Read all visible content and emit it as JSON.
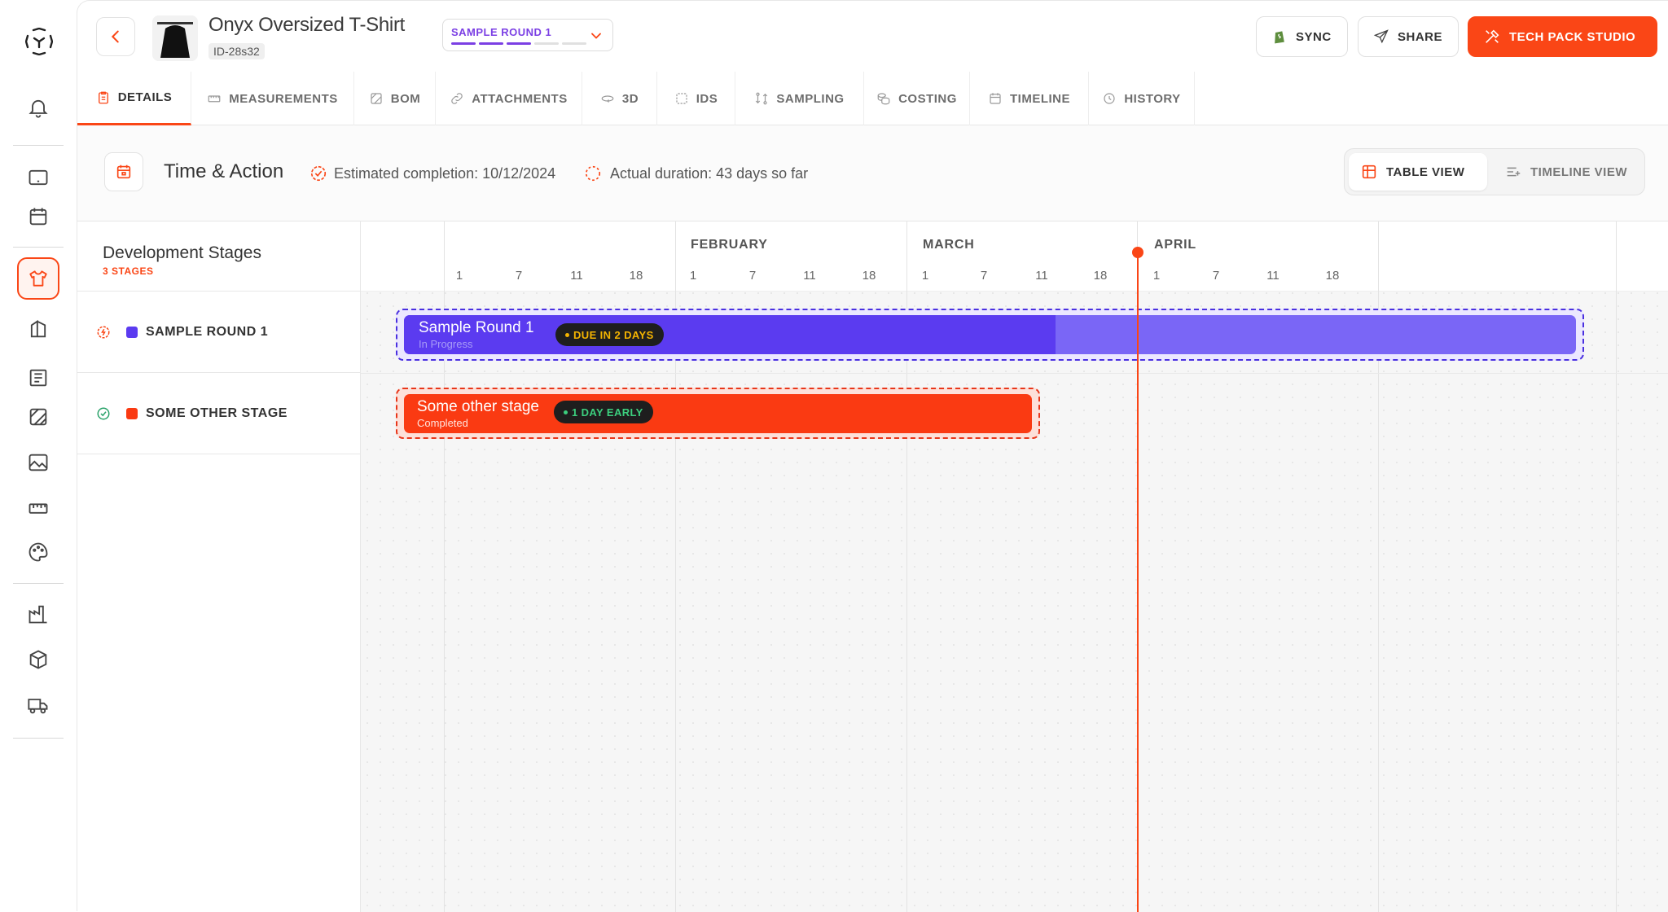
{
  "product": {
    "title": "Onyx Oversized T-Shirt",
    "id": "ID-28s32"
  },
  "round_selector": {
    "label": "SAMPLE ROUND 1",
    "progress_segments": 5,
    "progress_filled": 3
  },
  "header_buttons": {
    "sync": "SYNC",
    "share": "SHARE",
    "tech_pack": "TECH PACK STUDIO"
  },
  "tabs": [
    {
      "label": "DETAILS",
      "icon": "clipboard-icon",
      "active": true
    },
    {
      "label": "MEASUREMENTS",
      "icon": "ruler-icon",
      "active": false
    },
    {
      "label": "BOM",
      "icon": "layers-icon",
      "active": false
    },
    {
      "label": "ATTACHMENTS",
      "icon": "link-icon",
      "active": false
    },
    {
      "label": "3D",
      "icon": "3d-rotate-icon",
      "active": false
    },
    {
      "label": "IDS",
      "icon": "scan-icon",
      "active": false
    },
    {
      "label": "SAMPLING",
      "icon": "swap-icon",
      "active": false
    },
    {
      "label": "COSTING",
      "icon": "coins-icon",
      "active": false
    },
    {
      "label": "TIMELINE",
      "icon": "calendar-icon",
      "active": false
    },
    {
      "label": "HISTORY",
      "icon": "clock-icon",
      "active": false
    }
  ],
  "section": {
    "title": "Time & Action",
    "estimated_completion": "Estimated completion: 10/12/2024",
    "actual_duration": "Actual duration: 43 days so far"
  },
  "views": {
    "table": "TABLE VIEW",
    "timeline": "TIMELINE VIEW",
    "active": "table"
  },
  "stages_panel": {
    "title": "Development Stages",
    "count_label": "3 STAGES",
    "stages": [
      {
        "name": "SAMPLE ROUND 1",
        "color": "#5b3bf0",
        "status": "in-progress"
      },
      {
        "name": "SOME OTHER STAGE",
        "color": "#fa3a12",
        "status": "completed"
      }
    ]
  },
  "timeline": {
    "months": [
      "FEBRUARY",
      "MARCH",
      "APRIL"
    ],
    "days": [
      "1",
      "7",
      "11",
      "18",
      "1",
      "7",
      "11",
      "18",
      "1",
      "7",
      "11",
      "18",
      "1",
      "7",
      "11",
      "18"
    ],
    "bars": [
      {
        "title": "Sample Round 1",
        "subtitle": "In Progress",
        "badge": "DUE IN 2 DAYS",
        "color": "#5b3bf0",
        "progress": 0.54
      },
      {
        "title": "Some other stage",
        "subtitle": "Completed",
        "badge": "1 DAY EARLY",
        "color": "#fa3a12",
        "progress": 1.0
      }
    ]
  },
  "colors": {
    "accent": "#fa4616",
    "purple": "#5b3bf0",
    "purple_light": "#7a66f6"
  }
}
